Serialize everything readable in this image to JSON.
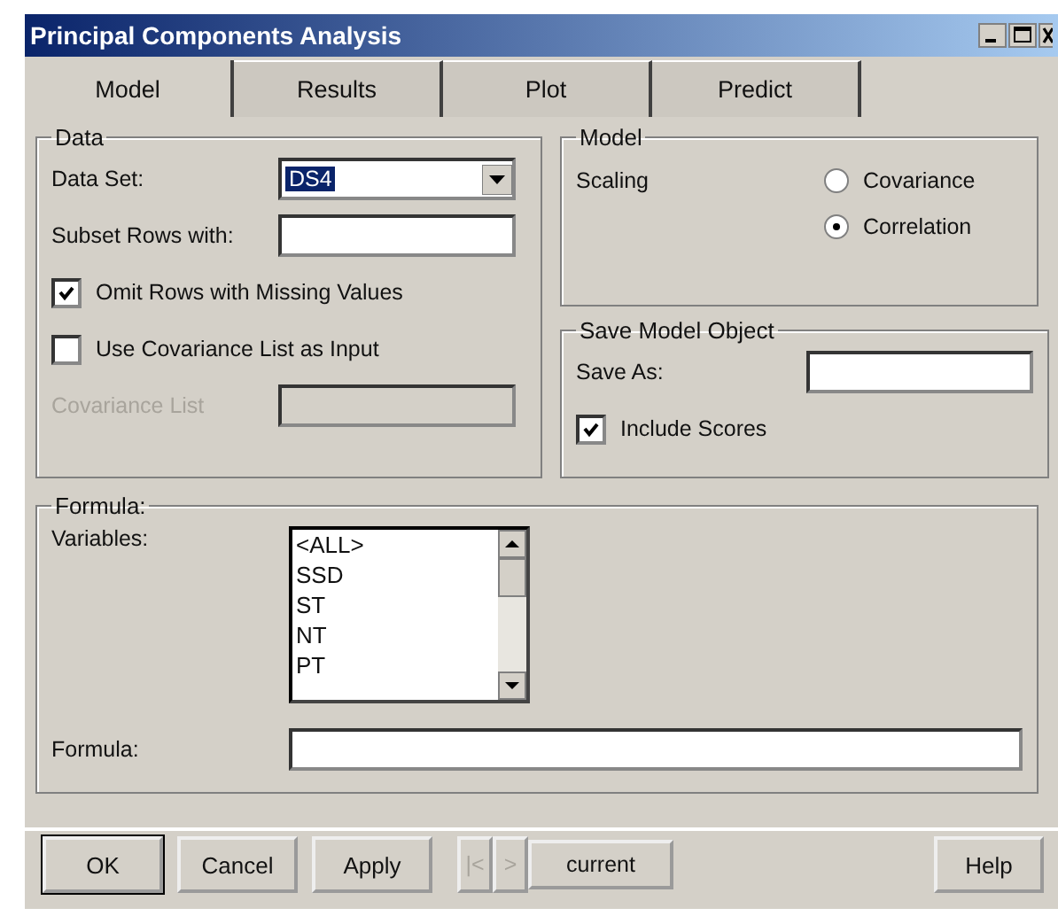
{
  "window": {
    "title": "Principal Components Analysis"
  },
  "tabs": [
    {
      "label": "Model",
      "selected": true
    },
    {
      "label": "Results",
      "selected": false
    },
    {
      "label": "Plot",
      "selected": false
    },
    {
      "label": "Predict",
      "selected": false
    }
  ],
  "data": {
    "title": "Data",
    "data_set": {
      "label": "Data Set:",
      "value": "DS4"
    },
    "subset": {
      "label": "Subset Rows with:"
    },
    "checks": [
      {
        "label": "Omit Rows with Missing Values",
        "checked": true
      },
      {
        "label": "Use Covariance List as Input",
        "checked": false
      }
    ],
    "covariance_list": {
      "label": "Covariance List",
      "disabled": true
    }
  },
  "model": {
    "title": "Model",
    "label": "Scaling",
    "options": [
      {
        "label": "Covariance",
        "selected": false
      },
      {
        "label": "Correlation",
        "selected": true
      }
    ]
  },
  "save": {
    "title": "Save Model Object",
    "label": "Save As:",
    "include_scores": {
      "label": "Include Scores",
      "checked": true
    }
  },
  "formula": {
    "title": "Formula:",
    "variables_label": "Variables:",
    "variables": [
      "<ALL>",
      "SSD",
      "ST",
      "NT",
      "PT"
    ],
    "formula_label": "Formula:"
  },
  "buttons": [
    "OK",
    "Cancel",
    "Apply"
  ],
  "nav": [
    {
      "label": "|<",
      "disabled": true
    },
    {
      "label": ">",
      "disabled": true
    }
  ],
  "current": "current",
  "help": "Help"
}
